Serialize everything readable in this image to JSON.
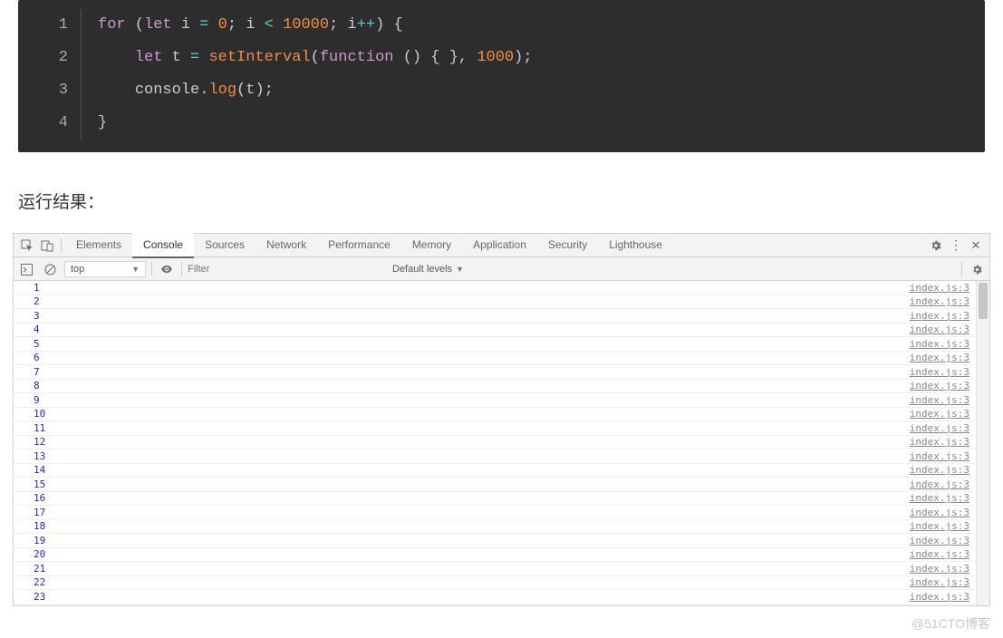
{
  "code": {
    "line_numbers": [
      "1",
      "2",
      "3",
      "4"
    ],
    "l1": {
      "for": "for",
      "lp": " (",
      "let1": "let",
      "sp1": " ",
      "i1": "i",
      "sp2": " ",
      "eq": "=",
      "sp3": " ",
      "zero": "0",
      "sc1": "; ",
      "i2": "i",
      "sp4": " ",
      "lt": "<",
      "sp5": " ",
      "n": "10000",
      "sc2": "; ",
      "i3": "i",
      "inc": "++",
      "rp": ") ",
      "ob": "{"
    },
    "l2": {
      "ind": "    ",
      "let": "let",
      "sp1": " ",
      "t": "t",
      "sp2": " ",
      "eq": "=",
      "sp3": " ",
      "si": "setInterval",
      "lp": "(",
      "fn": "function",
      "sp4": " ",
      "pp": "()",
      "sp5": " ",
      "br": "{ }",
      "cm": ", ",
      "ms": "1000",
      "rp": ")",
      "sc": ";"
    },
    "l3": {
      "ind": "    ",
      "cons": "console",
      "dot": ".",
      "log": "log",
      "lp": "(",
      "t": "t",
      "rp": ")",
      "sc": ";"
    },
    "l4": {
      "cb": "}"
    }
  },
  "section_title": "运行结果：",
  "devtools": {
    "tabs": [
      "Elements",
      "Console",
      "Sources",
      "Network",
      "Performance",
      "Memory",
      "Application",
      "Security",
      "Lighthouse"
    ],
    "active_tab_index": 1,
    "subbar": {
      "context": "top",
      "filter_placeholder": "Filter",
      "levels": "Default levels"
    },
    "console_rows": [
      {
        "v": "1",
        "s": "index.js:3"
      },
      {
        "v": "2",
        "s": "index.js:3"
      },
      {
        "v": "3",
        "s": "index.js:3"
      },
      {
        "v": "4",
        "s": "index.js:3"
      },
      {
        "v": "5",
        "s": "index.js:3"
      },
      {
        "v": "6",
        "s": "index.js:3"
      },
      {
        "v": "7",
        "s": "index.js:3"
      },
      {
        "v": "8",
        "s": "index.js:3"
      },
      {
        "v": "9",
        "s": "index.js:3"
      },
      {
        "v": "10",
        "s": "index.js:3"
      },
      {
        "v": "11",
        "s": "index.js:3"
      },
      {
        "v": "12",
        "s": "index.js:3"
      },
      {
        "v": "13",
        "s": "index.js:3"
      },
      {
        "v": "14",
        "s": "index.js:3"
      },
      {
        "v": "15",
        "s": "index.js:3"
      },
      {
        "v": "16",
        "s": "index.js:3"
      },
      {
        "v": "17",
        "s": "index.js:3"
      },
      {
        "v": "18",
        "s": "index.js:3"
      },
      {
        "v": "19",
        "s": "index.js:3"
      },
      {
        "v": "20",
        "s": "index.js:3"
      },
      {
        "v": "21",
        "s": "index.js:3"
      },
      {
        "v": "22",
        "s": "index.js:3"
      },
      {
        "v": "23",
        "s": "index.js:3"
      }
    ]
  },
  "watermark": "@51CTO博客"
}
